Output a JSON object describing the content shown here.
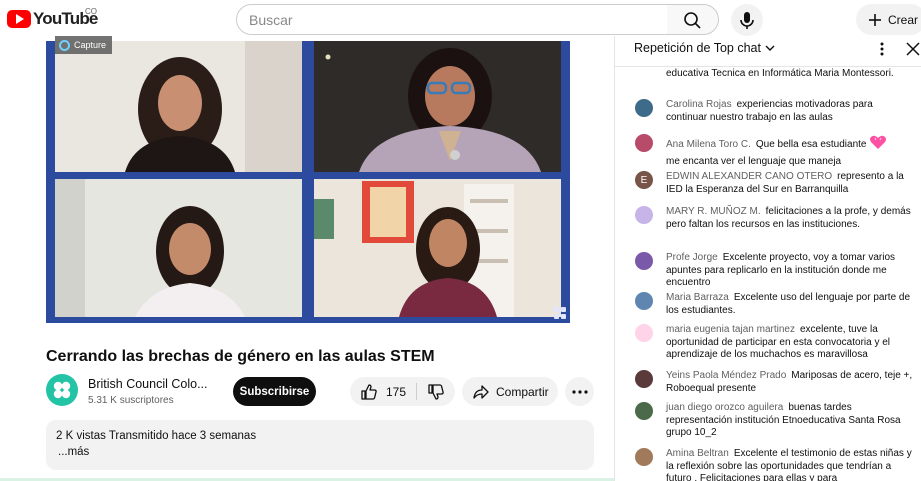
{
  "header": {
    "logo_text": "YouTube",
    "country_code": "CO",
    "search_placeholder": "Buscar",
    "create_label": "Crear"
  },
  "video": {
    "overlay_badge": "Capture",
    "title": "Cerrando las brechas de género en las aulas STEM"
  },
  "channel": {
    "name": "British Council Colo...",
    "subscribers": "5.31 K suscriptores",
    "subscribe_label": "Subscribirse"
  },
  "actions": {
    "like_count": "175",
    "share_label": "Compartir"
  },
  "description": {
    "meta": "2 K vistas  Transmitido hace 3 semanas",
    "more_label": "...más"
  },
  "chat": {
    "title": "Repetición de Top chat",
    "messages": [
      {
        "author": "",
        "text": "educativa Tecnica en Informática Maria Montessori.",
        "avatar_color": "#ffffff"
      },
      {
        "author": "Carolina Rojas",
        "text": "experiencias motivadoras para continuar nuestro trabajo en las aulas",
        "avatar_color": "#3f6b8a"
      },
      {
        "author": "Ana Milena Toro C.",
        "text": "Que bella esa estudiante",
        "text2": "me encanta ver el lenguaje que maneja",
        "avatar_color": "#b84a6a",
        "has_heart": true
      },
      {
        "author": "EDWIN ALEXANDER CANO OTERO",
        "text": "represento a la IED la Esperanza del Sur en Barranquilla",
        "avatar_color": "#795548",
        "avatar_letter": "E"
      },
      {
        "author": "MARY R. MUÑOZ M.",
        "text": "felicitaciones a la profe, y demás pero faltan los recursos en las instituciones.",
        "avatar_color": "#c7b4e8"
      },
      {
        "author": "Profe Jorge",
        "text": "Excelente proyecto, voy a tomar varios apuntes para replicarlo en la institución donde me encuentro",
        "avatar_color": "#7a5aa8"
      },
      {
        "author": "Maria Barraza",
        "text": "Excelente uso del lenguaje por parte de los estudiantes.",
        "avatar_color": "#5f86b0"
      },
      {
        "author": "maria eugenia tajan martinez",
        "text": "excelente, tuve la oportunidad de participar en esta convocatoria y el aprendizaje de los muchachos es maravillosa",
        "avatar_color": "#ffd3e8"
      },
      {
        "author": "Yeins Paola Méndez Prado",
        "text": "Mariposas de acero, teje +, Roboequal presente",
        "avatar_color": "#5a3a3a"
      },
      {
        "author": "juan diego orozco aguilera",
        "text": "buenas tardes representación institución Etnoeducativa Santa Rosa grupo 10_2",
        "avatar_color": "#4a6a4a"
      },
      {
        "author": "Amina Beltran",
        "text": "Excelente el testimonio de estas niñas y la reflexión sobre las oportunidades que tendrían a futuro . Felicitaciones para ellas y para",
        "avatar_color": "#a07a5a"
      }
    ]
  },
  "colors": {
    "brand_red": "#ff0000",
    "channel_avatar": "#23c4a6",
    "video_frame": "#2c4a9e",
    "heart": "#ff4fa3"
  },
  "icons": [
    "youtube-logo-icon",
    "search-icon",
    "mic-icon",
    "plus-icon",
    "channel-avatar-icon",
    "like-icon",
    "dislike-icon",
    "share-icon",
    "more-horizontal-icon",
    "chevron-down-icon",
    "more-vertical-icon",
    "close-icon",
    "heart-icon"
  ]
}
